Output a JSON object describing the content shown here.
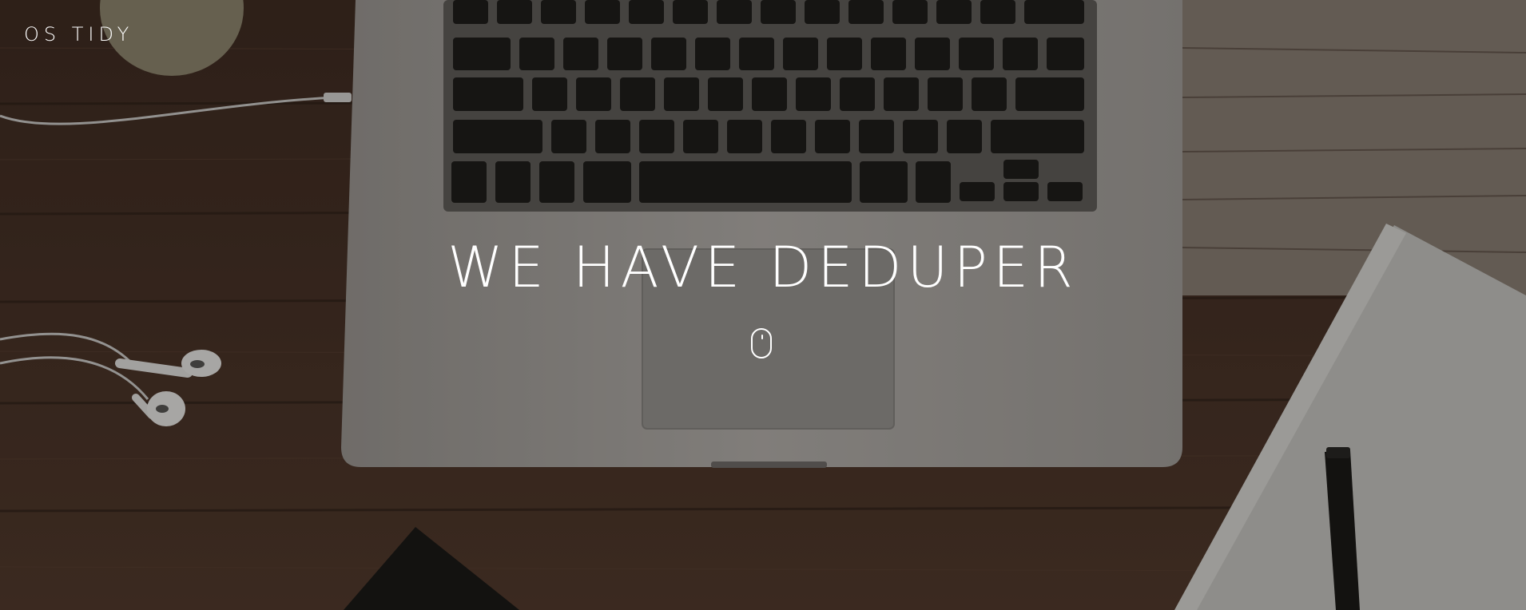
{
  "nav": {
    "brand": "OS TIDY"
  },
  "hero": {
    "headline": "WE HAVE DEDUPER",
    "scroll_icon": "mouse-scroll-icon",
    "background": "laptop-on-wooden-desk-photo"
  },
  "colors": {
    "text": "#ffffff",
    "wood": "#4a3328",
    "laptop": "#a8a6a4"
  }
}
